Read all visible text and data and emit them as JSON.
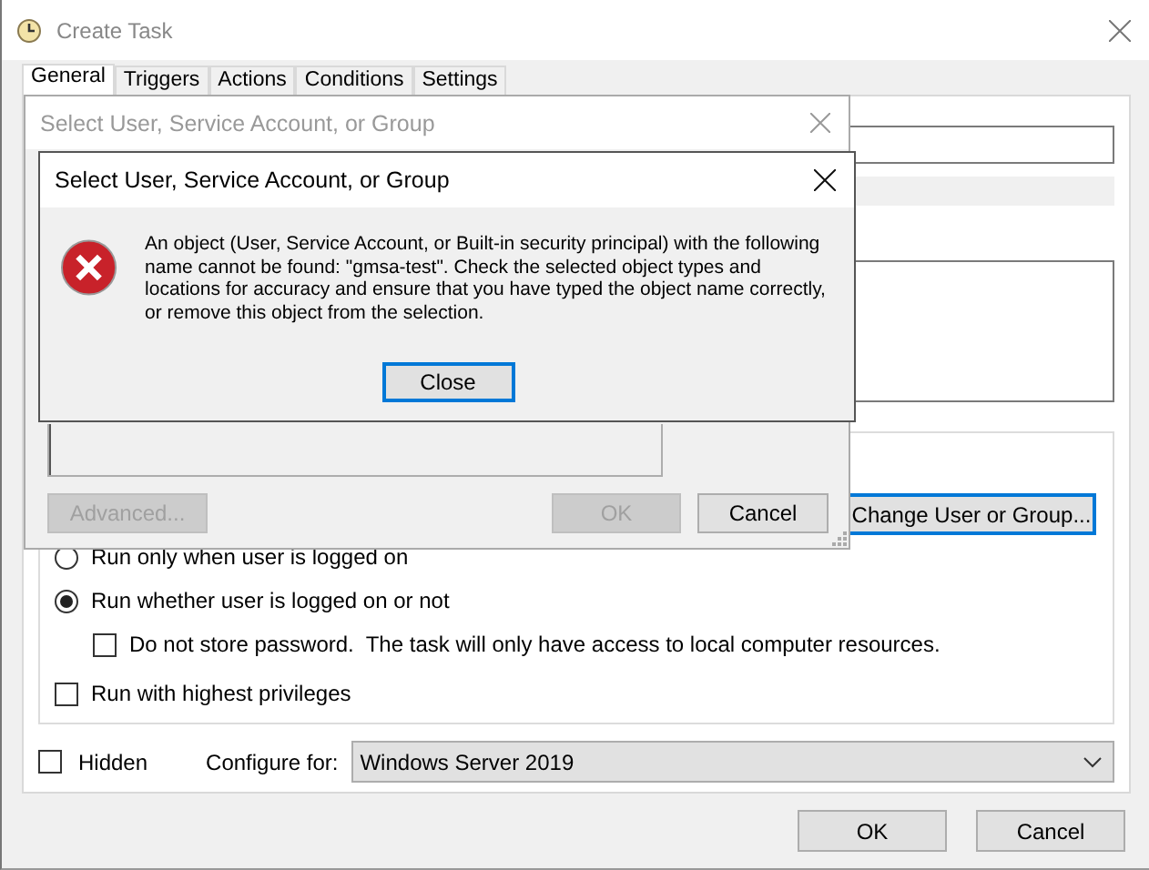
{
  "window": {
    "title": "Create Task"
  },
  "tabs": [
    {
      "label": "General",
      "selected": true
    },
    {
      "label": "Triggers",
      "selected": false
    },
    {
      "label": "Actions",
      "selected": false
    },
    {
      "label": "Conditions",
      "selected": false
    },
    {
      "label": "Settings",
      "selected": false
    }
  ],
  "security": {
    "change_button": "Change User or Group...",
    "options": [
      {
        "kind": "radio",
        "label": "Run only when user is logged on",
        "checked": false
      },
      {
        "kind": "radio",
        "label": "Run whether user is logged on or not",
        "checked": true,
        "children": [
          {
            "kind": "checkbox",
            "label": "Do not store password.  The task will only have access to local computer resources.",
            "checked": false
          }
        ]
      },
      {
        "kind": "checkbox",
        "label": "Run with highest privileges",
        "checked": false
      }
    ]
  },
  "hidden": {
    "label": "Hidden",
    "checked": false
  },
  "configure_for": {
    "label": "Configure for:",
    "value": "Windows Server 2019"
  },
  "buttons": [
    {
      "label": "OK"
    },
    {
      "label": "Cancel"
    }
  ],
  "select_dialog": {
    "title": "Select User, Service Account, or Group",
    "buttons": [
      {
        "label": "Advanced...",
        "disabled": true
      },
      {
        "label": "OK",
        "disabled": true
      },
      {
        "label": "Cancel",
        "disabled": false
      }
    ]
  },
  "error_dialog": {
    "title": "Select User, Service Account, or Group",
    "message": "An object (User, Service Account, or Built-in security principal) with the following name cannot be found: \"gmsa-test\". Check the selected object types and locations for accuracy and ensure that you have typed the object name correctly, or remove this object from the selection.",
    "button": "Close"
  }
}
